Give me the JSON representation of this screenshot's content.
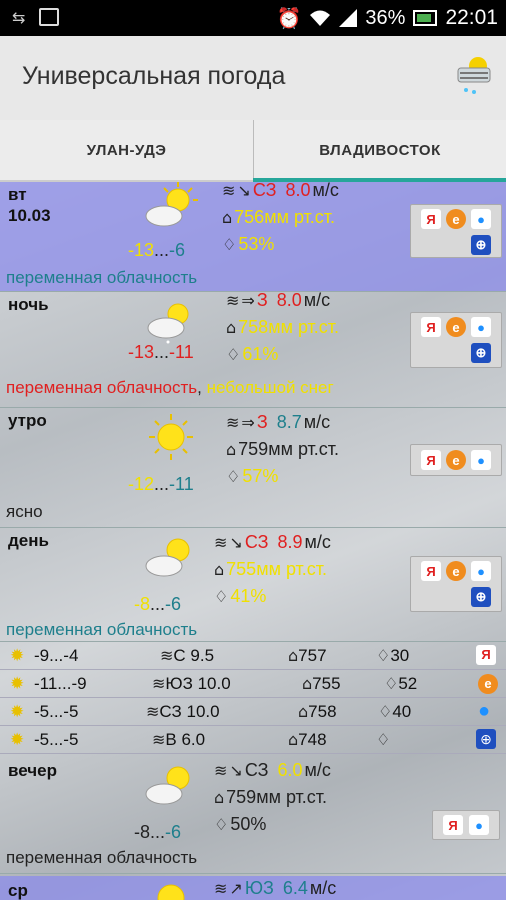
{
  "status": {
    "battery": "36%",
    "time": "22:01"
  },
  "app": {
    "title": "Универсальная погода"
  },
  "tabs": [
    {
      "label": "УЛАН-УДЭ"
    },
    {
      "label": "ВЛАДИВОСТОК"
    }
  ],
  "periods": [
    {
      "name": "вт",
      "date": "10.03",
      "temp_lo": "-13",
      "temp_sep": "...",
      "temp_hi": "-6",
      "wind_dir": "СЗ",
      "wind_speed": "8.0",
      "wind_unit": "м/с",
      "pressure": "756мм рт.ст.",
      "humidity": "53%",
      "desc": "переменная облачность"
    },
    {
      "name": "ночь",
      "temp_lo": "-13",
      "temp_sep": "...",
      "temp_hi": "-11",
      "wind_dir": "З",
      "wind_speed": "8.0",
      "wind_unit": "м/с",
      "pressure": "758мм рт.ст.",
      "humidity": "61%",
      "desc": "переменная облачность",
      "desc_sep": ", ",
      "desc2": "небольшой снег"
    },
    {
      "name": "утро",
      "temp_lo": "-12",
      "temp_sep": "...",
      "temp_hi": "-11",
      "wind_dir": "З",
      "wind_speed": "8.7",
      "wind_unit": "м/с",
      "pressure": "759мм рт.ст.",
      "humidity": "57%",
      "desc": "ясно"
    },
    {
      "name": "день",
      "temp_lo": "-8",
      "temp_sep": "...",
      "temp_hi": "-6",
      "wind_dir": "СЗ",
      "wind_speed": "8.9",
      "wind_unit": "м/с",
      "pressure": "755мм рт.ст.",
      "humidity": "41%",
      "desc": "переменная облачность"
    },
    {
      "name": "вечер",
      "temp_lo": "-8",
      "temp_sep": "...",
      "temp_hi": "-6",
      "wind_dir": "СЗ",
      "wind_speed": "6.0",
      "wind_unit": "м/с",
      "pressure": "759мм рт.ст.",
      "humidity": "50%",
      "desc": "переменная облачность"
    },
    {
      "name": "ср",
      "wind_dir": "ЮЗ",
      "wind_speed": "6.4",
      "wind_unit": "м/с"
    }
  ],
  "sources": [
    {
      "temp": "-9...-4",
      "wind": "С 9.5",
      "pressure": "757",
      "humidity": "30",
      "icon": "yandex-icon"
    },
    {
      "temp": "-11...-9",
      "wind": "ЮЗ 10.0",
      "pressure": "755",
      "humidity": "52",
      "icon": "e-icon"
    },
    {
      "temp": "-5...-5",
      "wind": "СЗ 10.0",
      "pressure": "758",
      "humidity": "40",
      "icon": "drop-icon"
    },
    {
      "temp": "-5...-5",
      "wind": "В 6.0",
      "pressure": "748",
      "humidity": "",
      "icon": "globe-icon"
    }
  ],
  "source_letters": {
    "yandex": "Я",
    "e": "e"
  }
}
